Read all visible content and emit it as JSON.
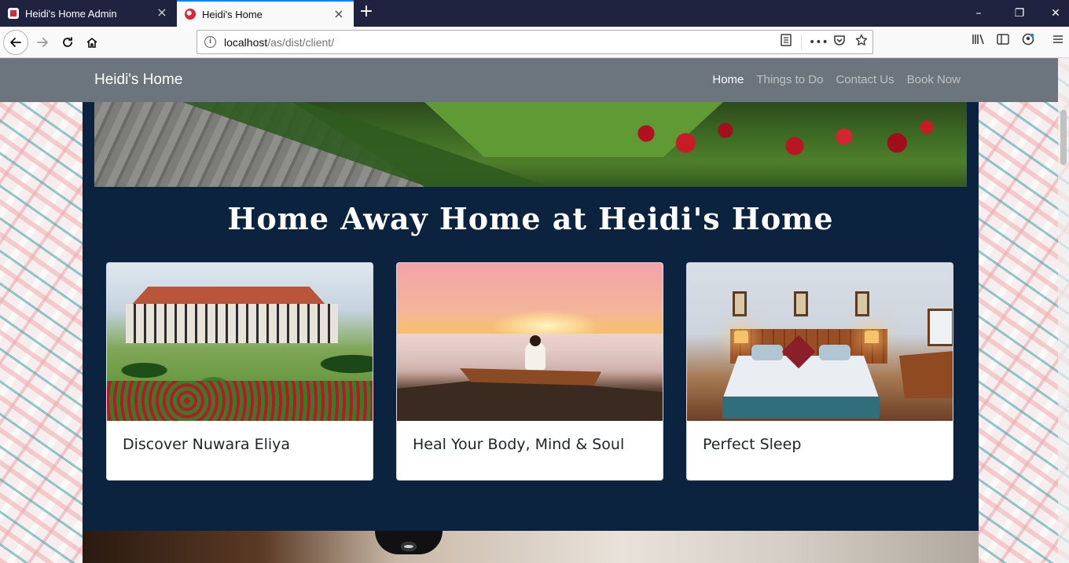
{
  "browser": {
    "tabs": [
      {
        "label": "Heidi's Home Admin",
        "active": false
      },
      {
        "label": "Heidi's Home",
        "active": true
      }
    ],
    "new_tab_symbol": "+",
    "url_host": "localhost",
    "url_path": "/as/dist/client/",
    "window_controls": {
      "minimize": "–",
      "restore": "❐",
      "close": "✕"
    },
    "icons": [
      "back-icon",
      "forward-icon",
      "reload-icon",
      "home-icon",
      "site-info-icon",
      "reader-view-icon",
      "page-actions-icon",
      "pocket-icon",
      "bookmark-star-icon",
      "library-icon",
      "sidebar-icon",
      "account-icon",
      "menu-icon"
    ]
  },
  "site": {
    "brand": "Heidi's Home",
    "nav": [
      {
        "label": "Home",
        "active": true
      },
      {
        "label": "Things to Do",
        "active": false
      },
      {
        "label": "Contact Us",
        "active": false
      },
      {
        "label": "Book Now",
        "active": false
      }
    ],
    "headline": "Home Away Home at Heidi's Home",
    "cards": [
      {
        "title": "Discover Nuwara Eliya"
      },
      {
        "title": "Heal Your Body, Mind & Soul"
      },
      {
        "title": "Perfect Sleep"
      }
    ]
  },
  "colors": {
    "tab_bar": "#202340",
    "active_tab_accent": "#0a84ff",
    "site_navbar": "#6c757d",
    "content_background": "#0c2340",
    "card_background": "#ffffff"
  }
}
